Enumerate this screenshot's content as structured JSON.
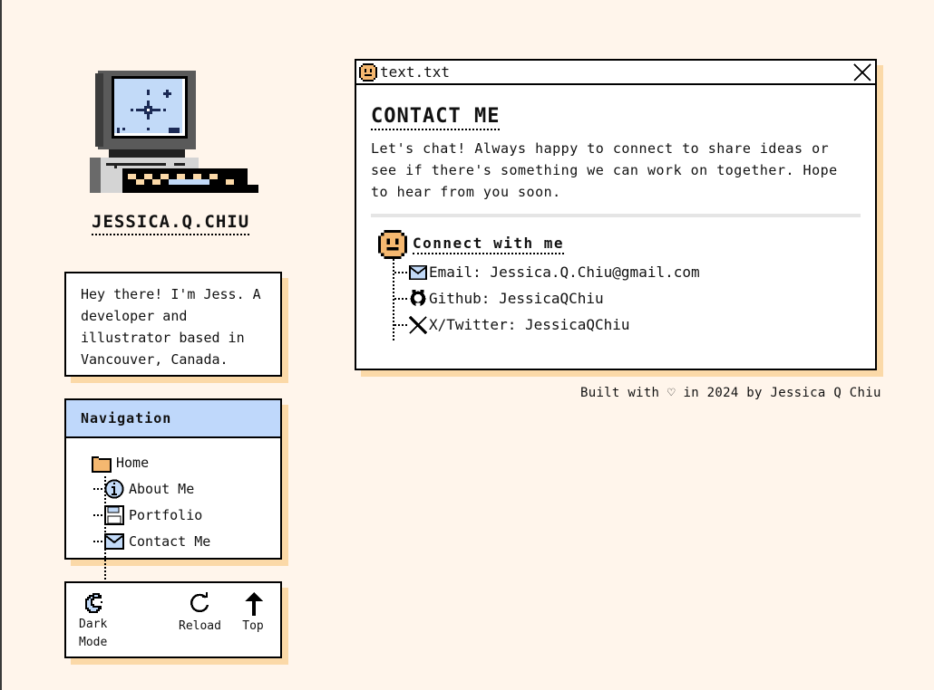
{
  "site": {
    "title": "JESSICA.Q.CHIU"
  },
  "bio": {
    "text": "Hey there! I'm Jess. A developer and illustrator based in Vancouver, Canada."
  },
  "navigation": {
    "heading": "Navigation",
    "root": {
      "label": "Home",
      "icon": "folder-icon"
    },
    "items": [
      {
        "label": "About Me",
        "icon": "info-icon"
      },
      {
        "label": "Portfolio",
        "icon": "floppy-disk-icon"
      },
      {
        "label": "Contact Me",
        "icon": "envelope-icon"
      }
    ]
  },
  "tools": {
    "dark_mode": "Dark Mode",
    "reload": "Reload",
    "top": "Top"
  },
  "window": {
    "title": "text.txt",
    "heading": "CONTACT ME",
    "intro": "Let's chat! Always happy to connect to share ideas or see if there's something we can work on together. Hope to hear from you soon.",
    "connect_heading": "Connect with me",
    "links": [
      {
        "label": "Email: Jessica.Q.Chiu@gmail.com",
        "icon": "envelope-icon"
      },
      {
        "label": "Github: JessicaQChiu",
        "icon": "github-icon"
      },
      {
        "label": "X/Twitter: JessicaQChiu",
        "icon": "x-twitter-icon"
      }
    ]
  },
  "footer": {
    "text": "Built with ♡ in 2024 by Jessica Q Chiu"
  },
  "colors": {
    "background": "#fff5eb",
    "shadow": "#fbd9a8",
    "accent_blue": "#bfd8fb",
    "face_orange": "#f5b870"
  }
}
